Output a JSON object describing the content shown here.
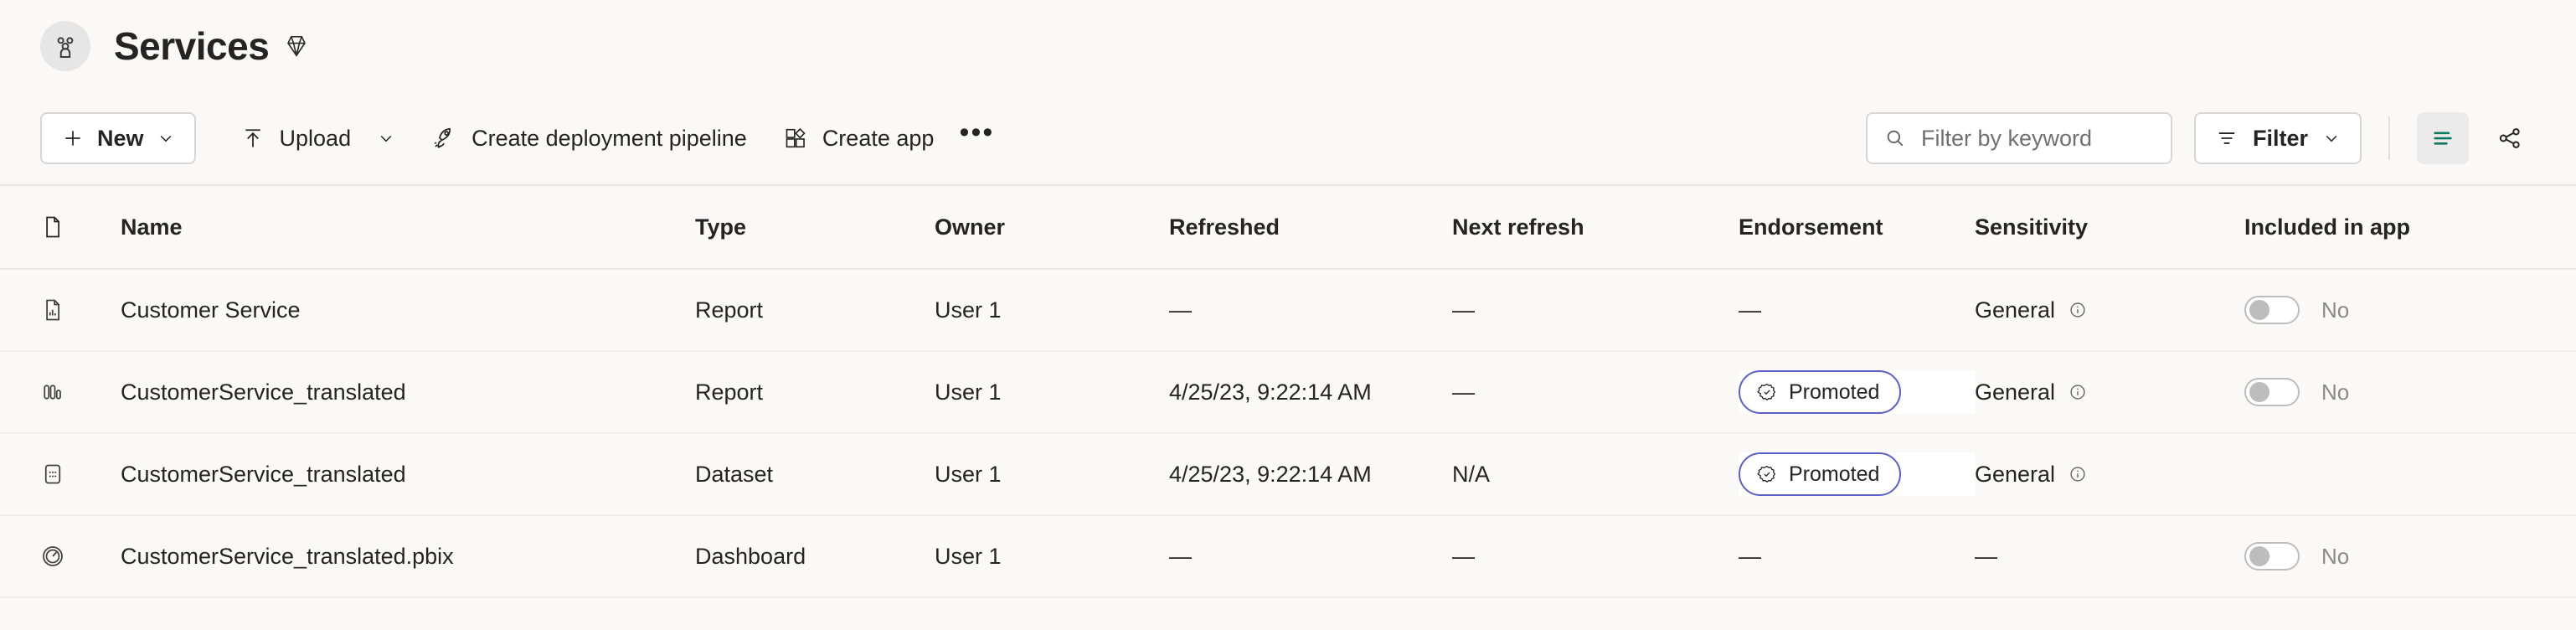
{
  "header": {
    "workspace_icon": "people-group-icon",
    "title": "Services",
    "badge_icon": "diamond-icon"
  },
  "toolbar": {
    "new_label": "New",
    "upload_label": "Upload",
    "create_pipeline_label": "Create deployment pipeline",
    "create_app_label": "Create app",
    "more_label": "•••",
    "filter_label": "Filter",
    "search": {
      "value": "",
      "placeholder": "Filter by keyword"
    },
    "view_list_icon": "list-view-icon",
    "lineage_icon": "share-lineage-icon",
    "accent_color": "#117865"
  },
  "table": {
    "columns": [
      {
        "key": "icon",
        "label": ""
      },
      {
        "key": "name",
        "label": "Name"
      },
      {
        "key": "type",
        "label": "Type"
      },
      {
        "key": "owner",
        "label": "Owner"
      },
      {
        "key": "refreshed",
        "label": "Refreshed"
      },
      {
        "key": "next_refresh",
        "label": "Next refresh"
      },
      {
        "key": "endorsement",
        "label": "Endorsement"
      },
      {
        "key": "sensitivity",
        "label": "Sensitivity"
      },
      {
        "key": "included_in_app",
        "label": "Included in app"
      }
    ],
    "rows": [
      {
        "icon": "report-icon",
        "name": "Customer Service",
        "type": "Report",
        "owner": "User 1",
        "refreshed": "—",
        "next_refresh": "—",
        "endorsement": "—",
        "endorsement_badge": null,
        "sensitivity": "General",
        "sensitivity_info_icon": "info-circle-icon",
        "included_in_app": "No",
        "included_in_app_toggle": "off"
      },
      {
        "icon": "paginated-report-icon",
        "name": "CustomerService_translated",
        "type": "Report",
        "owner": "User 1",
        "refreshed": "4/25/23, 9:22:14 AM",
        "next_refresh": "—",
        "endorsement": "",
        "endorsement_badge": "Promoted",
        "sensitivity": "General",
        "sensitivity_info_icon": "info-circle-icon",
        "included_in_app": "No",
        "included_in_app_toggle": "off"
      },
      {
        "icon": "dataset-icon",
        "name": "CustomerService_translated",
        "type": "Dataset",
        "owner": "User 1",
        "refreshed": "4/25/23, 9:22:14 AM",
        "next_refresh": "N/A",
        "endorsement": "",
        "endorsement_badge": "Promoted",
        "sensitivity": "General",
        "sensitivity_info_icon": "info-circle-icon",
        "included_in_app": "",
        "included_in_app_toggle": null
      },
      {
        "icon": "dashboard-icon",
        "name": "CustomerService_translated.pbix",
        "type": "Dashboard",
        "owner": "User 1",
        "refreshed": "—",
        "next_refresh": "—",
        "endorsement": "—",
        "endorsement_badge": null,
        "sensitivity": "—",
        "sensitivity_info_icon": null,
        "included_in_app": "No",
        "included_in_app_toggle": "off"
      }
    ]
  }
}
